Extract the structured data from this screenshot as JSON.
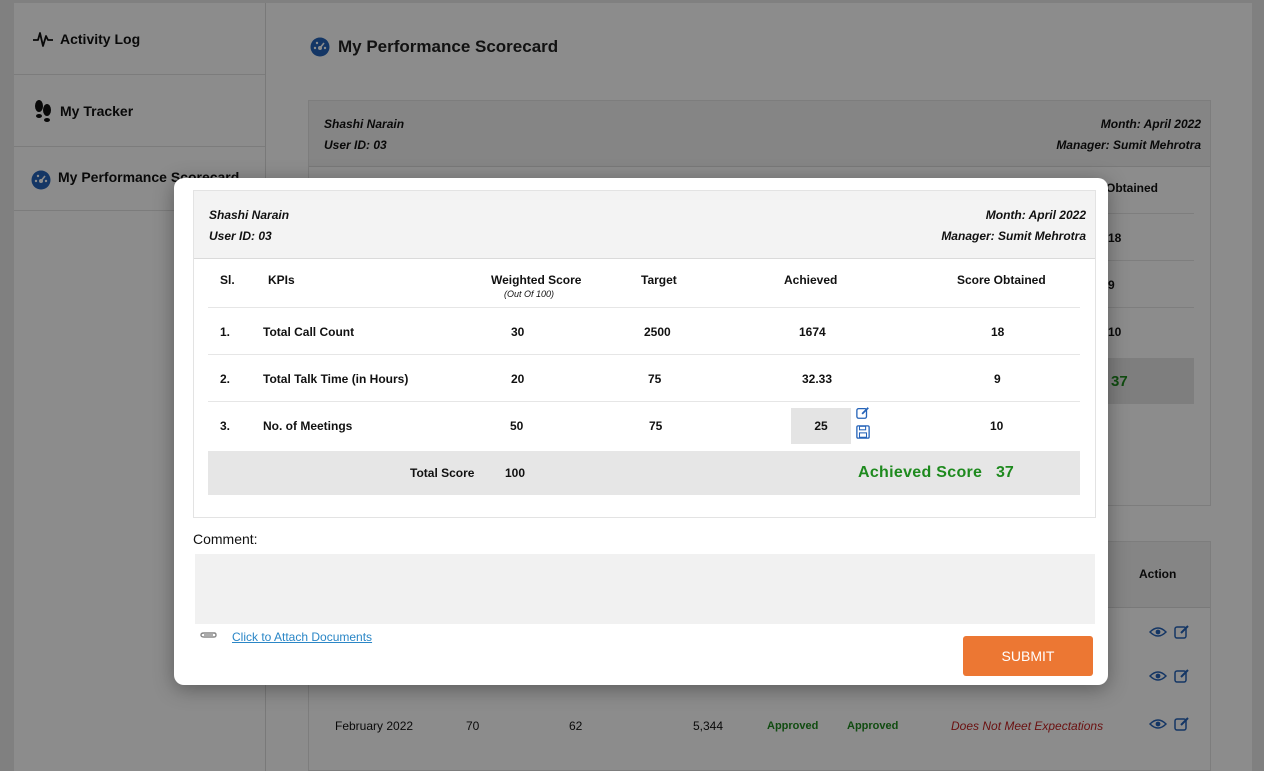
{
  "sidebar": {
    "items": [
      {
        "label": "Activity Log"
      },
      {
        "label": "My Tracker"
      },
      {
        "label": "My Performance Scorecard"
      }
    ]
  },
  "page": {
    "title": "My Performance Scorecard"
  },
  "background_card": {
    "employee_name": "Shashi Narain",
    "user_id": "User ID: 03",
    "month": "Month: April 2022",
    "manager": "Manager: Sumit Mehrotra",
    "peek_header": "Obtained",
    "peek_values": [
      "18",
      "9",
      "10"
    ],
    "peek_total": "37"
  },
  "history": {
    "action_header": "Action",
    "rows": [
      {
        "month": "February 2022",
        "c1": "70",
        "c2": "62",
        "c3": "5,344",
        "status1": "Approved",
        "status2": "Approved",
        "performance": "Does Not Meet Expectations"
      }
    ]
  },
  "modal": {
    "employee_name": "Shashi Narain",
    "user_id": "User ID: 03",
    "month": "Month: April 2022",
    "manager": "Manager: Sumit Mehrotra",
    "headers": {
      "sl": "Sl.",
      "kpis": "KPIs",
      "weighted": "Weighted Score",
      "weighted_sub": "(Out Of 100)",
      "target": "Target",
      "achieved": "Achieved",
      "score": "Score Obtained"
    },
    "rows": [
      {
        "sl": "1.",
        "kpi": "Total Call Count",
        "weighted": "30",
        "target": "2500",
        "achieved": "1674",
        "score": "18"
      },
      {
        "sl": "2.",
        "kpi": "Total Talk Time (in Hours)",
        "weighted": "20",
        "target": "75",
        "achieved": "32.33",
        "score": "9"
      },
      {
        "sl": "3.",
        "kpi": "No. of Meetings",
        "weighted": "50",
        "target": "75",
        "achieved": "25",
        "score": "10"
      }
    ],
    "total_label": "Total Score",
    "total_value": "100",
    "achieved_score_label": "Achieved Score",
    "achieved_score_value": "37",
    "comment_label": "Comment:",
    "comment_value": "",
    "attach_label": "Click to Attach Documents",
    "submit_label": "SUBMIT"
  },
  "colors": {
    "accent_orange": "#ec7733",
    "success_green": "#1e8a1e",
    "danger_red": "#c21f1f",
    "icon_blue": "#2563b8"
  }
}
